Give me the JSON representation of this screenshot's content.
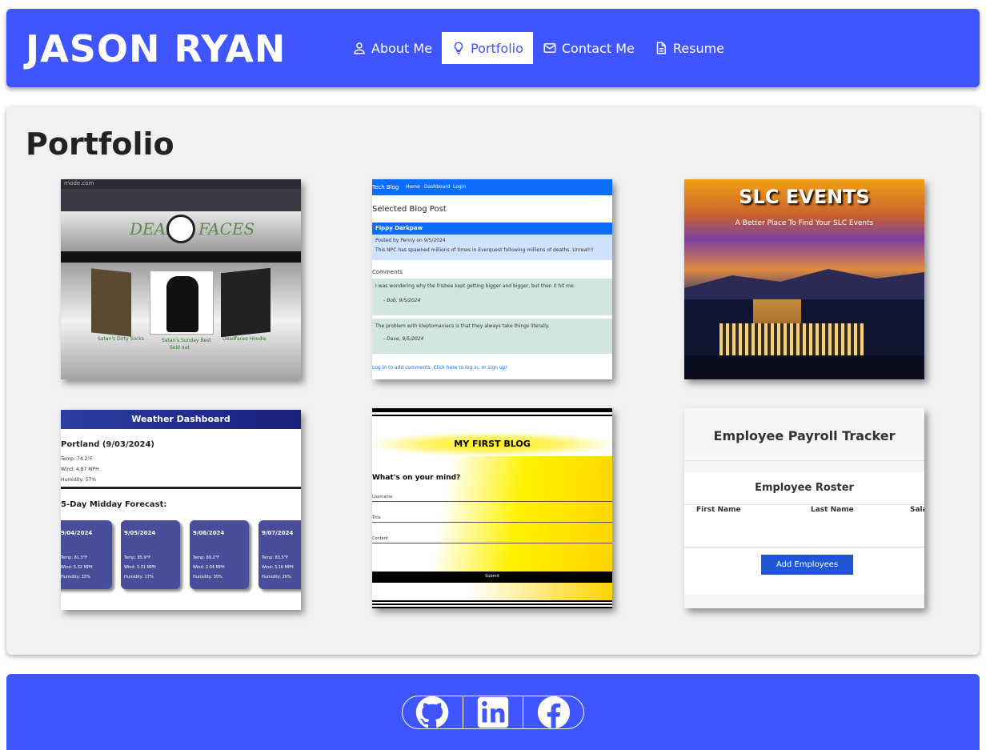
{
  "header": {
    "brand": "JASON RYAN",
    "nav": [
      {
        "label": "About Me",
        "icon": "user-icon"
      },
      {
        "label": "Portfolio",
        "icon": "lightbulb-icon",
        "active": true
      },
      {
        "label": "Contact Me",
        "icon": "envelope-icon"
      },
      {
        "label": "Resume",
        "icon": "document-icon"
      }
    ]
  },
  "main": {
    "title": "Portfolio",
    "projects": [
      {
        "name": "deadfaces",
        "screenshot": {
          "url_fragment": "rnode.com",
          "logo_left": "DEAD",
          "logo_right": "FACES",
          "item1": "Satan's Dirty Socks",
          "item2": "Satan's Sunday Best",
          "item2_sub": "Sold out",
          "item3": "Deadfaces Hoodie"
        }
      },
      {
        "name": "tech-blog",
        "screenshot": {
          "brand": "Tech Blog",
          "nav": [
            "Home",
            "Dashboard",
            "Login"
          ],
          "heading": "Selected Blog Post",
          "post_title": "Fippy Darkpaw",
          "post_meta": "Posted by Penny on 9/5/2024",
          "post_body": "This NPC has spawned millions of times in Everquest following millions of deaths. Unreal!!!",
          "comments_heading": "Comments",
          "comment1": "I was wondering why the frisbee kept getting bigger and bigger, but then it hit me.",
          "comment1_by": "- Bob, 9/5/2024",
          "comment2": "The problem with kleptomaniacs is that they always take things literally.",
          "comment2_by": "- Dave, 9/5/2024",
          "login_note": "Log in to add comments. Click here to log in, or sign up!"
        }
      },
      {
        "name": "slc-events",
        "screenshot": {
          "title": "SLC EVENTS",
          "tagline": "A Better Place To Find Your SLC Events"
        }
      },
      {
        "name": "weather-dashboard",
        "screenshot": {
          "title": "Weather Dashboard",
          "city": "Portland (9/03/2024)",
          "temp": "Temp: 74.2°F",
          "wind": "Wind: 4.87 MPH",
          "humidity": "Humidity: 57%",
          "forecast_heading": "5-Day Midday Forecast:",
          "days": [
            {
              "date": "9/04/2024",
              "temp": "Temp: 81.3°F",
              "wind": "Wind: 5.32 MPH",
              "hum": "Humidity: 33%"
            },
            {
              "date": "9/05/2024",
              "temp": "Temp: 85.9°F",
              "wind": "Wind: 3.31 MPH",
              "hum": "Humidity: 17%"
            },
            {
              "date": "9/06/2024",
              "temp": "Temp: 89.2°F",
              "wind": "Wind: 2.04 MPH",
              "hum": "Humidity: 30%"
            },
            {
              "date": "9/07/2024",
              "temp": "Temp: 83.5°F",
              "wind": "Wind: 3.16 MPH",
              "hum": "Humidity: 26%"
            }
          ]
        }
      },
      {
        "name": "my-first-blog",
        "screenshot": {
          "title": "MY FIRST BLOG",
          "prompt": "What's on your mind?",
          "field1": "Username",
          "field2": "Title",
          "field3": "Content",
          "submit": "Submit"
        }
      },
      {
        "name": "employee-payroll-tracker",
        "screenshot": {
          "title": "Employee Payroll Tracker",
          "roster": "Employee Roster",
          "col1": "First Name",
          "col2": "Last Name",
          "col3": "Sala",
          "button": "Add Employees"
        }
      }
    ]
  },
  "footer": {
    "links": [
      {
        "name": "GitHub",
        "icon": "github-icon"
      },
      {
        "name": "LinkedIn",
        "icon": "linkedin-icon"
      },
      {
        "name": "Facebook",
        "icon": "facebook-icon"
      }
    ]
  },
  "colors": {
    "accent": "#3f55ff",
    "panel": "#f1f1f3",
    "text": "#222222"
  }
}
